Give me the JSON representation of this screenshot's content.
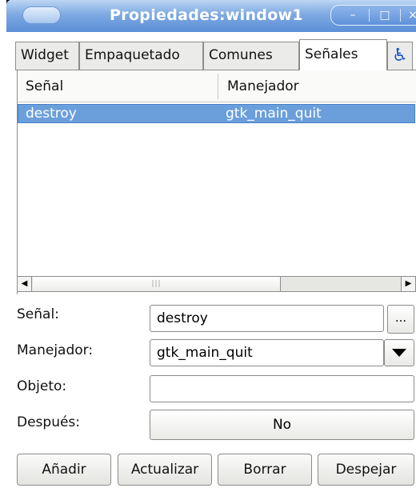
{
  "window": {
    "title": "Propiedades:window1",
    "controls": {
      "minimize": "–",
      "maximize": "□",
      "close": "×"
    }
  },
  "tabs": [
    {
      "label": "Widget",
      "active": false
    },
    {
      "label": "Empaquetado",
      "active": false
    },
    {
      "label": "Comunes",
      "active": false
    },
    {
      "label": "Señales",
      "active": true
    },
    {
      "icon": "accessibility-icon",
      "active": false
    }
  ],
  "signals_table": {
    "columns": [
      "Señal",
      "Manejador"
    ],
    "rows": [
      {
        "signal": "destroy",
        "handler": "gtk_main_quit",
        "selected": true
      }
    ],
    "scrollbar": {
      "left_arrow": "◀",
      "right_arrow": "▶",
      "grip": "|||"
    }
  },
  "form": {
    "signal_label": "Señal:",
    "signal_value": "destroy",
    "signal_browse": "...",
    "handler_label": "Manejador:",
    "handler_value": "gtk_main_quit",
    "object_label": "Objeto:",
    "object_value": "",
    "after_label": "Después:",
    "after_value": "No"
  },
  "actions": {
    "add": "Añadir",
    "update": "Actualizar",
    "delete": "Borrar",
    "clear": "Despejar"
  },
  "colors": {
    "selection": "#6b9fdc",
    "titlebar": "#5b8fd8",
    "accessibility": "#1b56c4"
  }
}
